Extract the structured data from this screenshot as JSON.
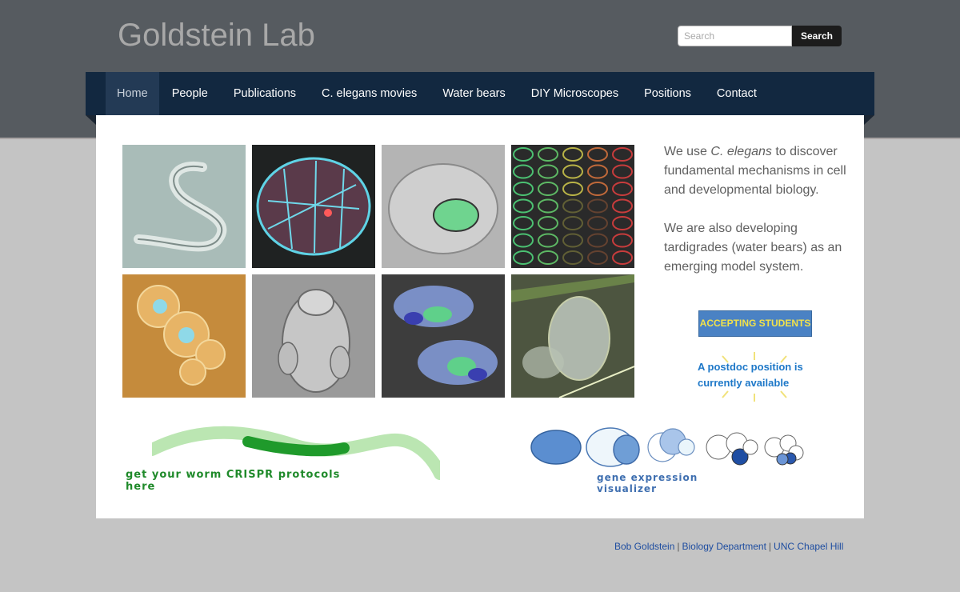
{
  "header": {
    "site_title": "Goldstein Lab",
    "search_placeholder": "Search",
    "search_button": "Search"
  },
  "nav": {
    "items": [
      {
        "label": "Home",
        "active": true
      },
      {
        "label": "People"
      },
      {
        "label": "Publications"
      },
      {
        "label": "C. elegans movies"
      },
      {
        "label": "Water bears"
      },
      {
        "label": "DIY Microscopes"
      },
      {
        "label": "Positions"
      },
      {
        "label": "Contact"
      }
    ]
  },
  "gallery": {
    "tiles": [
      "c-elegans-worm-image",
      "embryo-fluorescence-image",
      "embryo-green-nucleus-image",
      "embryo-array-image",
      "cells-blue-nuclei-image",
      "tardigrade-sem-image",
      "3d-cell-render-image",
      "tardigrade-micrograph-image"
    ]
  },
  "intro": {
    "p1_prefix": "We use ",
    "p1_italic": "C. elegans",
    "p1_suffix": " to discover fundamental mechanisms in cell and developmental biology.",
    "p2": "We are also developing tardigrades (water bears) as an emerging model system."
  },
  "accepting_students": "ACCEPTING STUDENTS",
  "postdoc": "A postdoc position is currently available",
  "crispr_banner": "get your worm CRISPR protocols here",
  "gev_banner": "gene expression visualizer",
  "footer": {
    "links": [
      "Bob Goldstein",
      "Biology Department",
      "UNC Chapel Hill"
    ],
    "separator": "|"
  },
  "colors": {
    "header_bg": "#565b60",
    "nav_bg": "#122840",
    "page_bg": "#c4c4c4",
    "accent_blue": "#4a82c4",
    "button_text_yellow": "#f2e24a",
    "crispr_green": "#1f8a2a"
  }
}
